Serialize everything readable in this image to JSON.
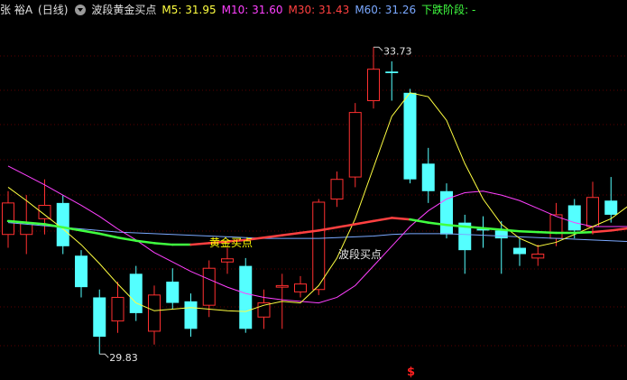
{
  "header": {
    "stock_name": "张 裕A",
    "period": "(日线)",
    "indicator": "波段黄金买点",
    "ma5": "M5: 31.95",
    "ma10": "M10: 31.60",
    "ma30": "M30: 31.43",
    "ma60": "M60: 31.26",
    "phase": "下跌阶段: -"
  },
  "colors": {
    "up": "#ff3030",
    "down": "#54ffff",
    "ma5": "#ffff40",
    "ma10": "#ff40ff",
    "ma30": "#ff4040",
    "ma60": "#7aa8ff",
    "phase": "#40ff40",
    "label": "#e6e6e6",
    "gold_label": "#ffff00"
  },
  "annotations": {
    "high_label": "33.73",
    "low_label": "29.83",
    "gold_buy": "黄金买点",
    "band_buy": "波段买点",
    "signal": "$"
  },
  "chart_data": {
    "type": "candlestick",
    "ylim": [
      29.5,
      34.1
    ],
    "candles": [
      {
        "o": 31.35,
        "c": 31.75,
        "h": 31.9,
        "l": 31.18
      },
      {
        "o": 31.35,
        "c": 31.5,
        "h": 31.85,
        "l": 31.1
      },
      {
        "o": 31.55,
        "c": 31.72,
        "h": 32.05,
        "l": 31.35
      },
      {
        "o": 31.75,
        "c": 31.2,
        "h": 31.85,
        "l": 31.1
      },
      {
        "o": 31.08,
        "c": 30.68,
        "h": 31.15,
        "l": 30.55
      },
      {
        "o": 30.55,
        "c": 30.05,
        "h": 30.65,
        "l": 29.83
      },
      {
        "o": 30.25,
        "c": 30.55,
        "h": 30.75,
        "l": 30.1
      },
      {
        "o": 30.85,
        "c": 30.35,
        "h": 30.95,
        "l": 30.25
      },
      {
        "o": 30.12,
        "c": 30.58,
        "h": 30.7,
        "l": 29.95
      },
      {
        "o": 30.75,
        "c": 30.48,
        "h": 30.92,
        "l": 30.4
      },
      {
        "o": 30.5,
        "c": 30.15,
        "h": 30.6,
        "l": 30.05
      },
      {
        "o": 30.45,
        "c": 30.92,
        "h": 31.02,
        "l": 30.3
      },
      {
        "o": 31.0,
        "c": 31.04,
        "h": 31.18,
        "l": 30.85
      },
      {
        "o": 30.95,
        "c": 30.15,
        "h": 31.05,
        "l": 30.1
      },
      {
        "o": 30.3,
        "c": 30.48,
        "h": 30.65,
        "l": 30.15
      },
      {
        "o": 30.68,
        "c": 30.7,
        "h": 30.85,
        "l": 30.15
      },
      {
        "o": 30.62,
        "c": 30.72,
        "h": 30.82,
        "l": 30.55
      },
      {
        "o": 30.65,
        "c": 31.76,
        "h": 31.8,
        "l": 30.58
      },
      {
        "o": 31.8,
        "c": 32.05,
        "h": 32.15,
        "l": 31.7
      },
      {
        "o": 32.08,
        "c": 32.9,
        "h": 33.02,
        "l": 31.95
      },
      {
        "o": 33.05,
        "c": 33.45,
        "h": 33.73,
        "l": 32.95
      },
      {
        "o": 33.42,
        "c": 33.4,
        "h": 33.55,
        "l": 33.05
      },
      {
        "o": 33.15,
        "c": 32.05,
        "h": 33.2,
        "l": 32.0
      },
      {
        "o": 32.25,
        "c": 31.9,
        "h": 32.45,
        "l": 31.75
      },
      {
        "o": 31.9,
        "c": 31.35,
        "h": 32.0,
        "l": 31.3
      },
      {
        "o": 31.5,
        "c": 31.15,
        "h": 31.6,
        "l": 30.85
      },
      {
        "o": 31.42,
        "c": 31.4,
        "h": 31.58,
        "l": 31.18
      },
      {
        "o": 31.4,
        "c": 31.3,
        "h": 31.52,
        "l": 30.85
      },
      {
        "o": 31.18,
        "c": 31.1,
        "h": 31.3,
        "l": 30.95
      },
      {
        "o": 31.05,
        "c": 31.1,
        "h": 31.22,
        "l": 30.95
      },
      {
        "o": 31.3,
        "c": 31.6,
        "h": 31.75,
        "l": 31.2
      },
      {
        "o": 31.72,
        "c": 31.4,
        "h": 31.8,
        "l": 31.3
      },
      {
        "o": 31.45,
        "c": 31.82,
        "h": 32.02,
        "l": 31.35
      },
      {
        "o": 31.78,
        "c": 31.6,
        "h": 32.08,
        "l": 31.5
      }
    ],
    "ma5": [
      31.95,
      31.78,
      31.6,
      31.42,
      31.22,
      30.98,
      30.72,
      30.48,
      30.38,
      30.4,
      30.42,
      30.4,
      30.38,
      30.37,
      30.45,
      30.5,
      30.48,
      30.7,
      31.05,
      31.55,
      32.2,
      32.85,
      33.15,
      33.1,
      32.8,
      32.25,
      31.8,
      31.48,
      31.3,
      31.2,
      31.25,
      31.35,
      31.45,
      31.55,
      31.72
    ],
    "ma10": [
      32.22,
      32.1,
      31.98,
      31.85,
      31.72,
      31.58,
      31.42,
      31.28,
      31.12,
      31.0,
      30.88,
      30.78,
      30.68,
      30.6,
      30.55,
      30.52,
      30.5,
      30.48,
      30.55,
      30.7,
      30.95,
      31.2,
      31.45,
      31.65,
      31.8,
      31.88,
      31.9,
      31.85,
      31.78,
      31.68,
      31.58,
      31.5,
      31.45,
      31.45,
      31.45
    ],
    "ma30": [
      31.52,
      31.5,
      31.48,
      31.44,
      31.4,
      31.36,
      31.31,
      31.27,
      31.24,
      31.22,
      31.22,
      31.24,
      31.26,
      31.28,
      31.31,
      31.34,
      31.37,
      31.4,
      31.44,
      31.48,
      31.52,
      31.56,
      31.54,
      31.5,
      31.47,
      31.45,
      31.43,
      31.41,
      31.39,
      31.38,
      31.37,
      31.37,
      31.38,
      31.4,
      31.43
    ],
    "ma30_phase": [
      "g",
      "g",
      "g",
      "g",
      "g",
      "g",
      "g",
      "g",
      "g",
      "g",
      "r",
      "r",
      "r",
      "r",
      "r",
      "r",
      "r",
      "r",
      "r",
      "r",
      "r",
      "r",
      "g",
      "g",
      "g",
      "g",
      "g",
      "g",
      "g",
      "g",
      "g",
      "g",
      "r",
      "r",
      "r"
    ],
    "ma60": [
      31.5,
      31.48,
      31.46,
      31.44,
      31.42,
      31.4,
      31.38,
      31.37,
      31.36,
      31.35,
      31.34,
      31.33,
      31.32,
      31.31,
      31.3,
      31.3,
      31.3,
      31.3,
      31.31,
      31.32,
      31.33,
      31.35,
      31.36,
      31.36,
      31.36,
      31.35,
      31.34,
      31.33,
      31.32,
      31.31,
      31.3,
      31.29,
      31.28,
      31.27,
      31.26
    ]
  }
}
